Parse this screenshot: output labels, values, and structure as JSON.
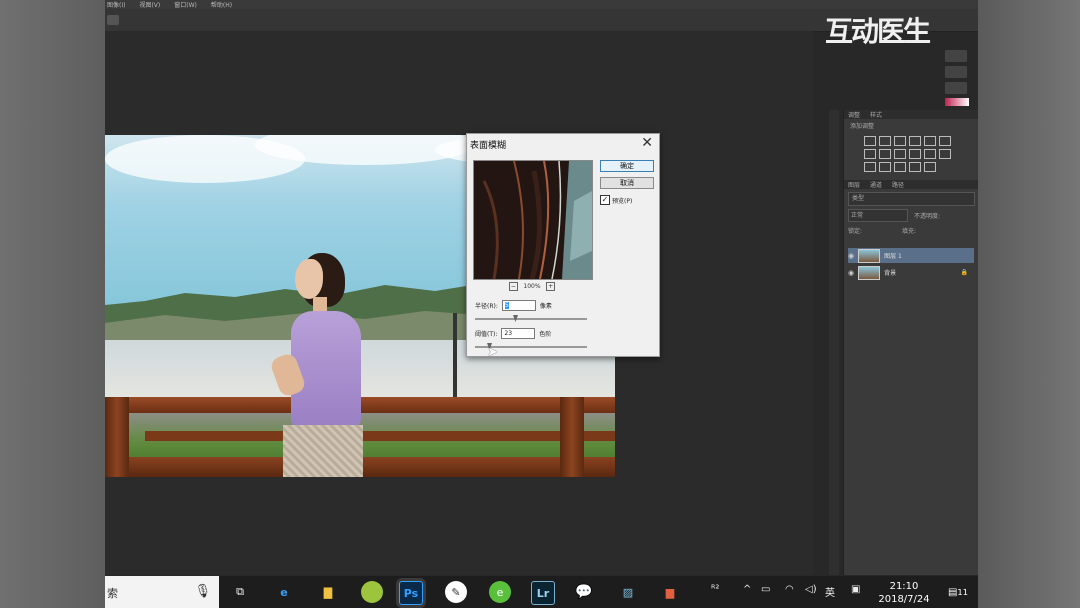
{
  "menubar": [
    "图像(I)",
    "视图(V)",
    "窗口(W)",
    "帮助(H)"
  ],
  "watermark_text": "互动医生",
  "dialog": {
    "title": "表面模糊",
    "ok": "确定",
    "cancel": "取消",
    "preview_label": "预览(P)",
    "preview_checked": "✓",
    "zoom": "100%",
    "zoom_out": "−",
    "zoom_in": "+",
    "radius_label": "半径(R):",
    "radius_value": "5",
    "radius_unit": "像素",
    "threshold_label": "阈值(T):",
    "threshold_value": "23",
    "threshold_unit": "色阶"
  },
  "panel": {
    "tabs": [
      "调整",
      "样式"
    ],
    "subtitle": "添加调整",
    "layer_tabs": [
      "图层",
      "通道",
      "路径"
    ],
    "kind": "类型",
    "blend": "正常",
    "opacity_label": "不透明度:",
    "lock_label": "锁定:",
    "fill_label": "填充:",
    "layers": [
      {
        "name": "图层 1",
        "active": true
      },
      {
        "name": "背景",
        "active": false
      }
    ]
  },
  "taskbar": {
    "search_text": "索",
    "apps": [
      "taskview",
      "edge",
      "explorer",
      "app-green",
      "Ps",
      "app-white",
      "app-green2",
      "Lr",
      "wechat",
      "app-blue",
      "app-store"
    ],
    "tray": [
      "ᴿ²",
      "^",
      "▭",
      "wifi",
      "🔊",
      "英",
      "▣"
    ],
    "time": "21:10",
    "date": "2018/7/24",
    "notif": "11"
  }
}
